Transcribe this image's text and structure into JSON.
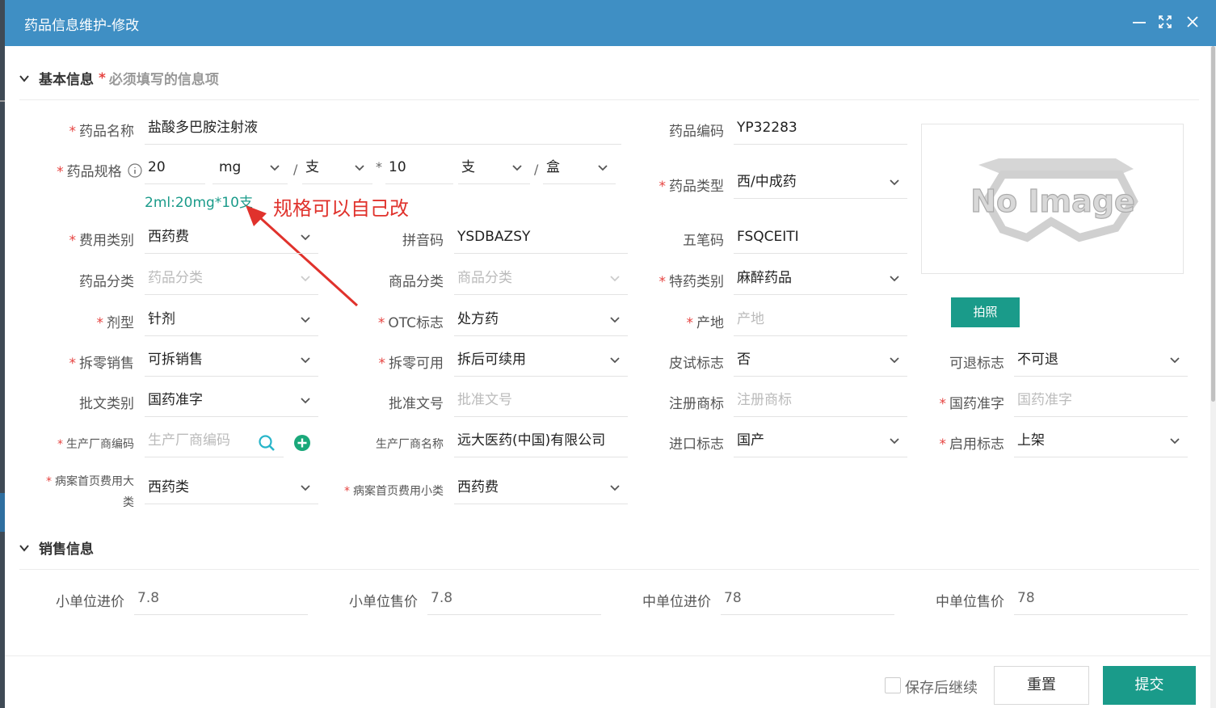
{
  "window": {
    "title": "药品信息维护-修改"
  },
  "sections": {
    "basic": {
      "title": "基本信息",
      "required_star": "*",
      "hint": "必须填写的信息项"
    },
    "sales": {
      "title": "销售信息"
    }
  },
  "form": {
    "drug_name": {
      "label": "药品名称",
      "value": "盐酸多巴胺注射液"
    },
    "drug_code": {
      "label": "药品编码",
      "value": "YP32283"
    },
    "spec": {
      "label": "药品规格",
      "amount": "20",
      "unit": "mg",
      "sep1": "/",
      "unit2": "支",
      "sep2": "*",
      "count": "10",
      "unit3": "支",
      "sep3": "/",
      "pack": "盒",
      "preview": "2ml:20mg*10支"
    },
    "drug_type": {
      "label": "药品类型",
      "value": "西/中成药"
    },
    "fee_category": {
      "label": "费用类别",
      "value": "西药费"
    },
    "pinyin": {
      "label": "拼音码",
      "value": "YSDBAZSY"
    },
    "wubi": {
      "label": "五笔码",
      "value": "FSQCEITI"
    },
    "drug_class": {
      "label": "药品分类",
      "placeholder": "药品分类"
    },
    "goods_class": {
      "label": "商品分类",
      "placeholder": "商品分类"
    },
    "special_drug": {
      "label": "特药类别",
      "value": "麻醉药品"
    },
    "dosage_form": {
      "label": "剂型",
      "value": "针剂"
    },
    "otc": {
      "label": "OTC标志",
      "value": "处方药"
    },
    "origin": {
      "label": "产地",
      "placeholder": "产地"
    },
    "split_sale": {
      "label": "拆零销售",
      "value": "可拆销售"
    },
    "split_usable": {
      "label": "拆零可用",
      "value": "拆后可续用"
    },
    "skin_test": {
      "label": "皮试标志",
      "value": "否"
    },
    "returnable": {
      "label": "可退标志",
      "value": "不可退"
    },
    "approval_type": {
      "label": "批文类别",
      "value": "国药准字"
    },
    "approval_no": {
      "label": "批准文号",
      "placeholder": "批准文号"
    },
    "trademark": {
      "label": "注册商标",
      "placeholder": "注册商标"
    },
    "national_approval": {
      "label": "国药准字",
      "placeholder": "国药准字"
    },
    "manufacturer_code": {
      "label": "生产厂商编码",
      "placeholder": "生产厂商编码"
    },
    "manufacturer_name": {
      "label": "生产厂商名称",
      "value": "远大医药(中国)有限公司"
    },
    "import_flag": {
      "label": "进口标志",
      "value": "国产"
    },
    "enable_flag": {
      "label": "启用标志",
      "value": "上架"
    },
    "record_big": {
      "label_line1": "病案首页费用大",
      "label_line2": "类",
      "value": "西药类"
    },
    "record_small": {
      "label": "病案首页费用小类",
      "value": "西药费"
    }
  },
  "sales": {
    "small_buy": {
      "label": "小单位进价",
      "value": "7.8"
    },
    "small_sell": {
      "label": "小单位售价",
      "value": "7.8"
    },
    "mid_buy": {
      "label": "中单位进价",
      "value": "78"
    },
    "mid_sell": {
      "label": "中单位售价",
      "value": "78"
    }
  },
  "image": {
    "placeholder_text": "No Image",
    "photo_button": "拍照"
  },
  "annotation": {
    "text": "规格可以自己改"
  },
  "footer": {
    "continue_label": "保存后继续",
    "reset": "重置",
    "submit": "提交"
  },
  "colors": {
    "titlebar": "#3f8fc4",
    "primary": "#1a9b8a",
    "required": "#e64340",
    "annotation": "#e0322c"
  }
}
